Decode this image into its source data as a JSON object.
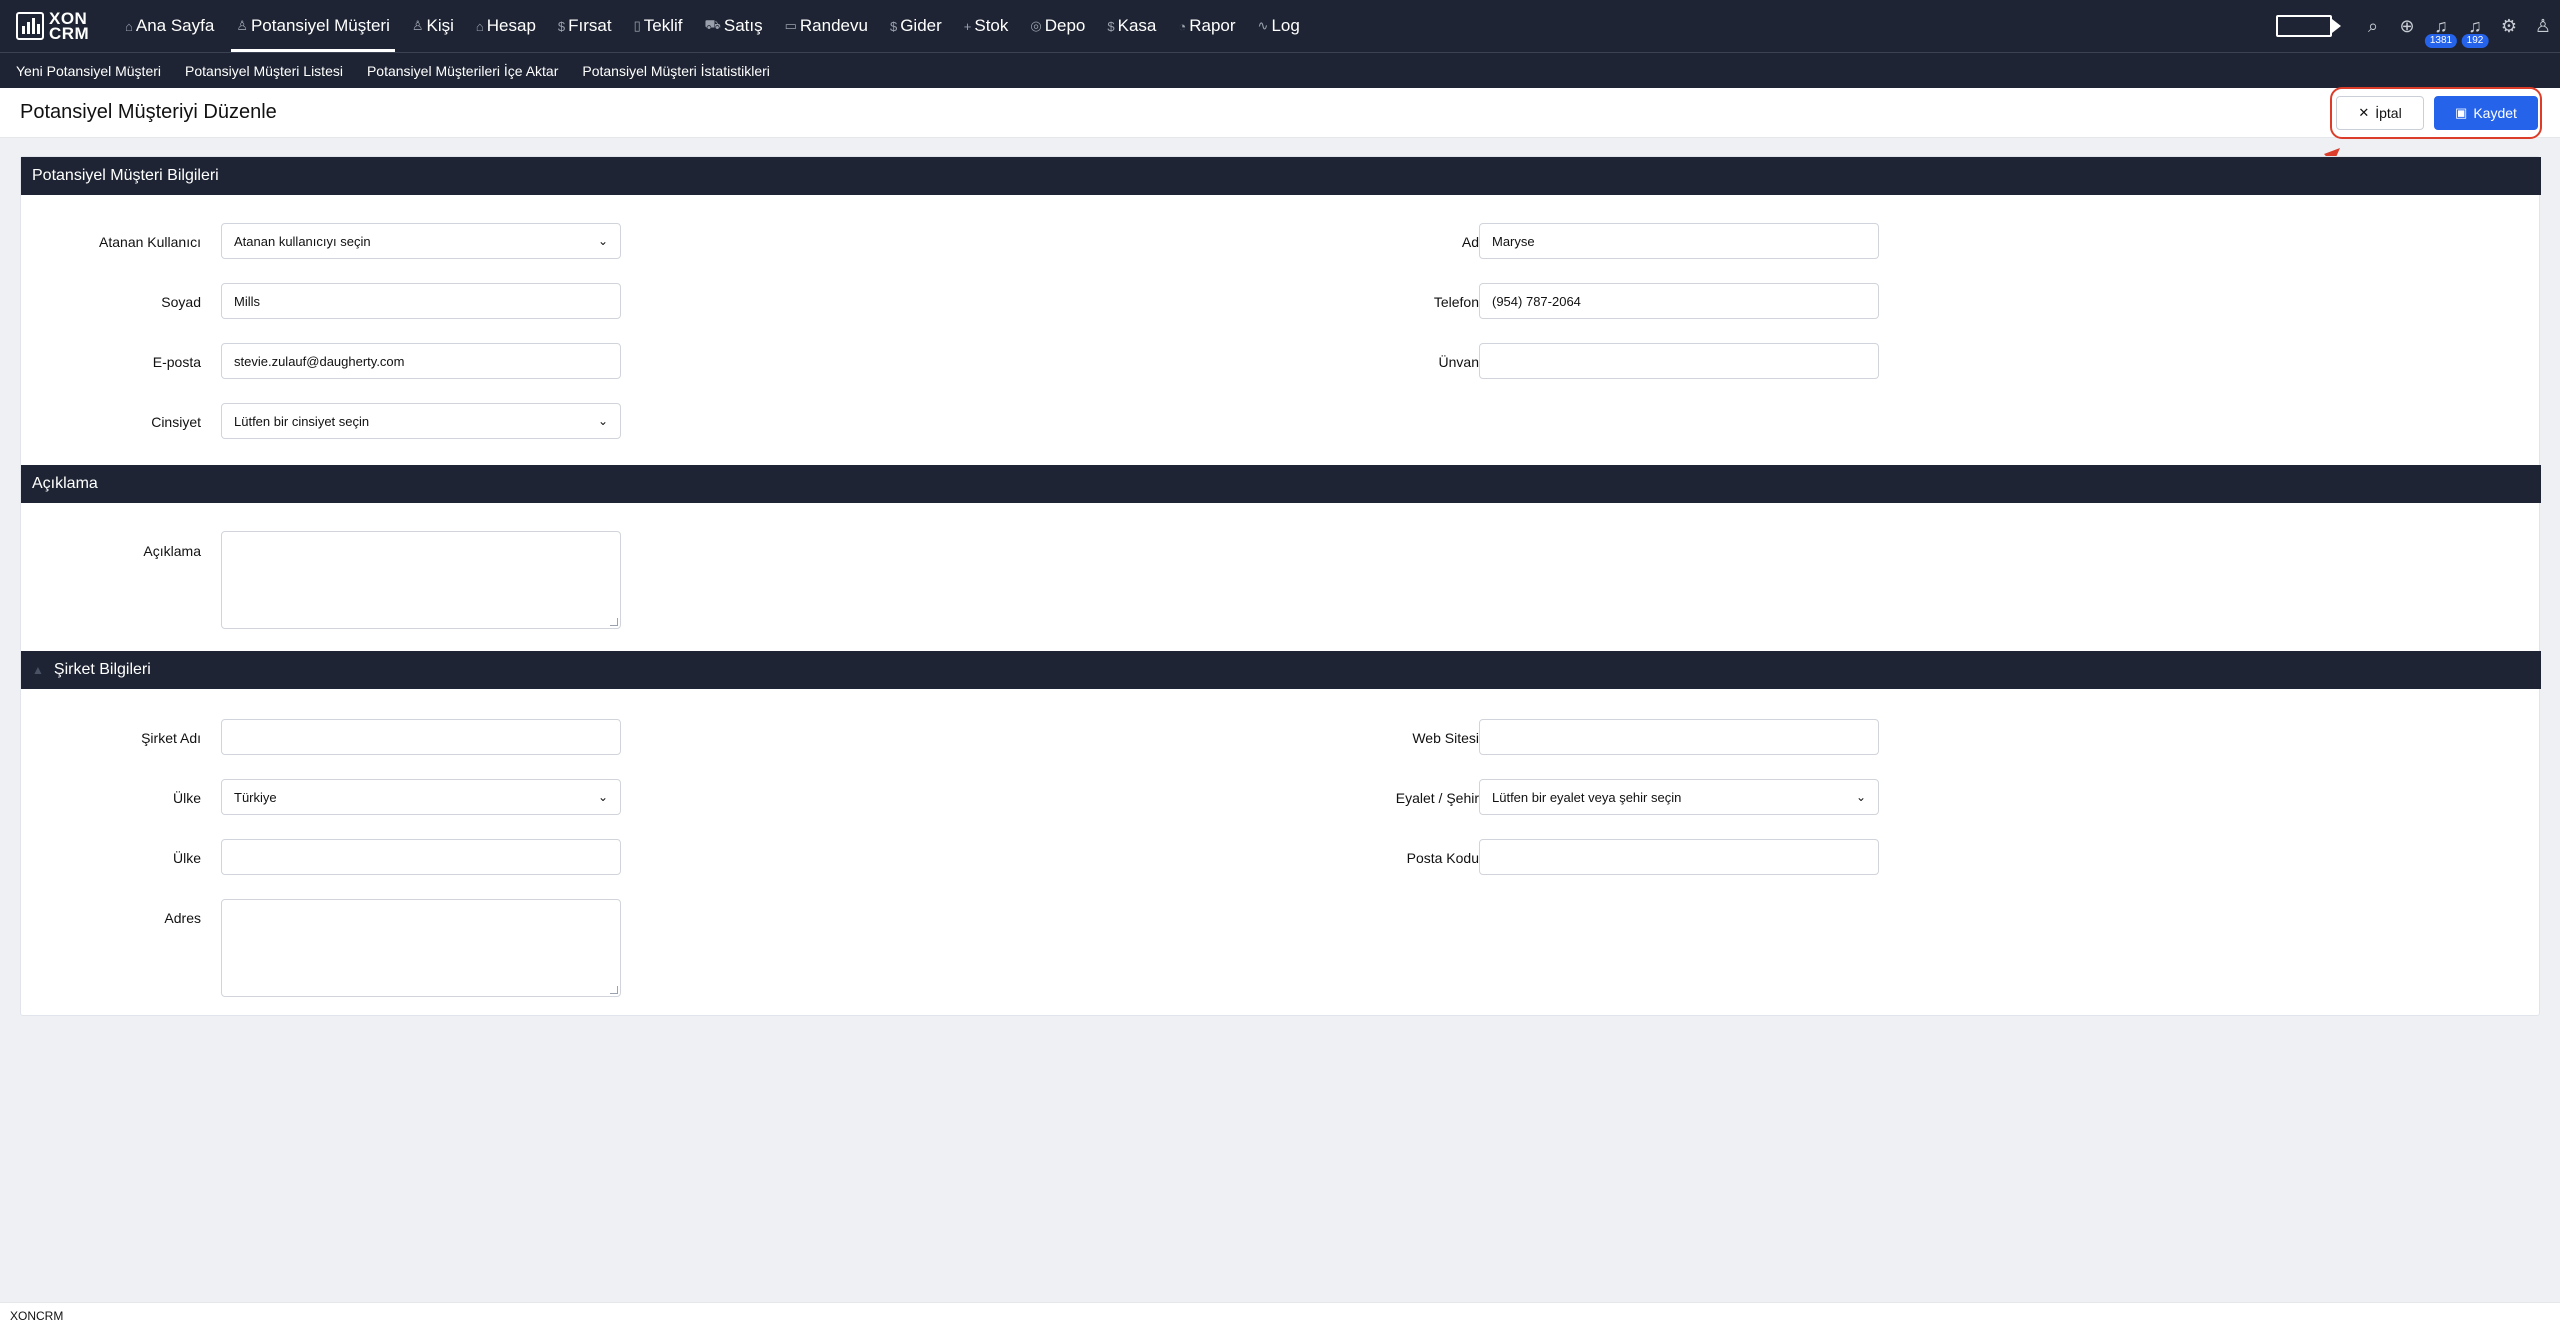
{
  "logo": {
    "line1": "XON",
    "line2": "CRM"
  },
  "nav": [
    {
      "label": "Ana Sayfa",
      "icon": "home-icon",
      "glyph": "⌂"
    },
    {
      "label": "Potansiyel Müşteri",
      "icon": "user-icon",
      "glyph": "♙",
      "active": true
    },
    {
      "label": "Kişi",
      "icon": "users-icon",
      "glyph": "♙"
    },
    {
      "label": "Hesap",
      "icon": "building-icon",
      "glyph": "⌂"
    },
    {
      "label": "Fırsat",
      "icon": "dollar-icon",
      "glyph": "$"
    },
    {
      "label": "Teklif",
      "icon": "document-icon",
      "glyph": "▯"
    },
    {
      "label": "Satış",
      "icon": "cart-icon",
      "glyph": "⛟"
    },
    {
      "label": "Randevu",
      "icon": "calendar-icon",
      "glyph": "▭"
    },
    {
      "label": "Gider",
      "icon": "dollar-icon",
      "glyph": "$"
    },
    {
      "label": "Stok",
      "icon": "plus-icon",
      "glyph": "+"
    },
    {
      "label": "Depo",
      "icon": "box-icon",
      "glyph": "◎"
    },
    {
      "label": "Kasa",
      "icon": "dollar-icon",
      "glyph": "$"
    },
    {
      "label": "Rapor",
      "icon": "chart-icon",
      "glyph": "◔"
    },
    {
      "label": "Log",
      "icon": "activity-icon",
      "glyph": "∿"
    }
  ],
  "notifications": {
    "count1": "1381",
    "count2": "192"
  },
  "subnav": [
    "Yeni Potansiyel Müşteri",
    "Potansiyel Müşteri Listesi",
    "Potansiyel Müşterileri İçe Aktar",
    "Potansiyel Müşteri İstatistikleri"
  ],
  "page": {
    "title": "Potansiyel Müşteriyi Düzenle",
    "cancel_label": "İptal",
    "save_label": "Kaydet"
  },
  "sections": {
    "lead_info": "Potansiyel Müşteri Bilgileri",
    "description": "Açıklama",
    "company": "Şirket Bilgileri"
  },
  "form": {
    "assigned_user": {
      "label": "Atanan Kullanıcı",
      "value": "Atanan kullanıcıyı seçin"
    },
    "first_name": {
      "label": "Ad",
      "value": "Maryse"
    },
    "last_name": {
      "label": "Soyad",
      "value": "Mills"
    },
    "phone": {
      "label": "Telefon",
      "value": "(954) 787-2064"
    },
    "email": {
      "label": "E-posta",
      "value": "stevie.zulauf@daugherty.com"
    },
    "title": {
      "label": "Ünvan",
      "value": ""
    },
    "gender": {
      "label": "Cinsiyet",
      "value": "Lütfen bir cinsiyet seçin"
    },
    "description": {
      "label": "Açıklama",
      "value": ""
    },
    "company_name": {
      "label": "Şirket Adı",
      "value": ""
    },
    "website": {
      "label": "Web Sitesi",
      "value": ""
    },
    "country_select": {
      "label": "Ülke",
      "value": "Türkiye"
    },
    "state_city": {
      "label": "Eyalet / Şehir",
      "value": "Lütfen bir eyalet veya şehir seçin"
    },
    "country_text": {
      "label": "Ülke",
      "value": ""
    },
    "postal_code": {
      "label": "Posta Kodu",
      "value": ""
    },
    "address": {
      "label": "Adres",
      "value": ""
    }
  },
  "footer": "XONCRM",
  "annotation_color": "#dc3d2a",
  "accent_color": "#2563eb"
}
